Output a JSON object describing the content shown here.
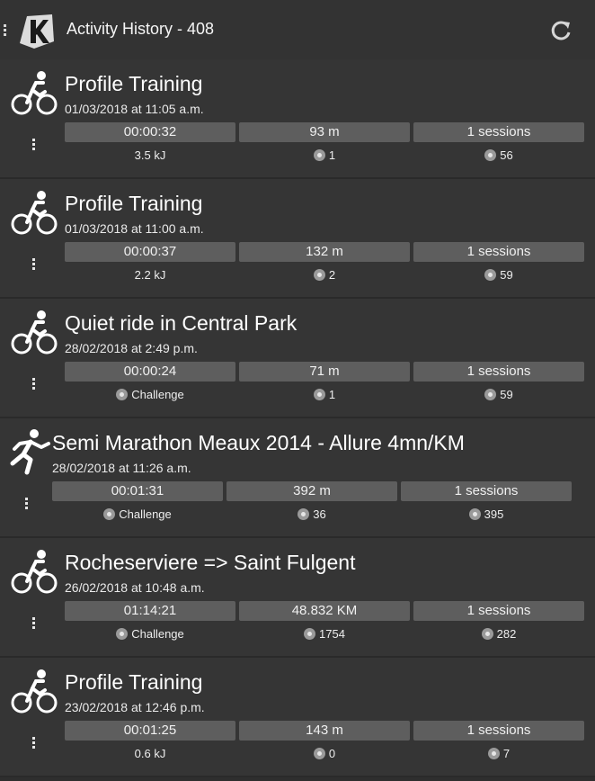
{
  "app": {
    "title": "Activity History - 408"
  },
  "activities": [
    {
      "sport": "bike",
      "name": "Profile Training",
      "date": "01/03/2018 at 11:05 a.m.",
      "duration": "00:00:32",
      "distance": "93 m",
      "sessions": "1 sessions",
      "energy": "3.5 kJ",
      "count1": "1",
      "count2": "56"
    },
    {
      "sport": "bike",
      "name": "Profile Training",
      "date": "01/03/2018 at 11:00 a.m.",
      "duration": "00:00:37",
      "distance": "132 m",
      "sessions": "1 sessions",
      "energy": "2.2 kJ",
      "count1": "2",
      "count2": "59"
    },
    {
      "sport": "bike",
      "name": "Quiet ride in Central Park",
      "date": "28/02/2018 at 2:49 p.m.",
      "duration": "00:00:24",
      "distance": "71 m",
      "sessions": "1 sessions",
      "energy": "Challenge",
      "count1": "1",
      "count2": "59"
    },
    {
      "sport": "run",
      "name": "Semi Marathon Meaux 2014 - Allure 4mn/KM",
      "date": "28/02/2018 at 11:26 a.m.",
      "duration": "00:01:31",
      "distance": "392 m",
      "sessions": "1 sessions",
      "energy": "Challenge",
      "count1": "36",
      "count2": "395"
    },
    {
      "sport": "bike",
      "name": "Rocheserviere => Saint Fulgent",
      "date": "26/02/2018 at 10:48 a.m.",
      "duration": "01:14:21",
      "distance": "48.832 KM",
      "sessions": "1 sessions",
      "energy": "Challenge",
      "count1": "1754",
      "count2": "282"
    },
    {
      "sport": "bike",
      "name": "Profile Training",
      "date": "23/02/2018 at 12:46 p.m.",
      "duration": "00:01:25",
      "distance": "143 m",
      "sessions": "1 sessions",
      "energy": "0.6 kJ",
      "count1": "0",
      "count2": "7"
    }
  ],
  "icons": {
    "bike": "bicycle-icon",
    "run": "runner-icon",
    "refresh": "refresh-icon",
    "more": "more-vertical-icon"
  }
}
